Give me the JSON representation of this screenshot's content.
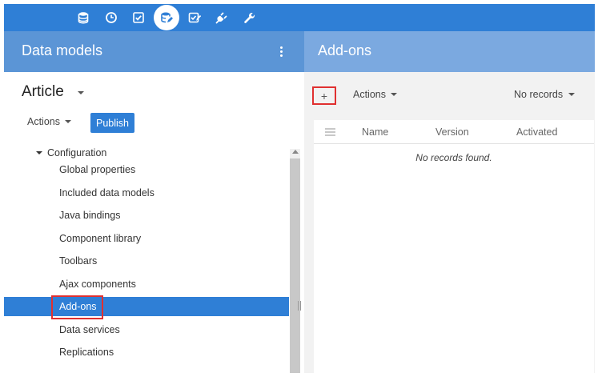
{
  "topbar": {
    "icons": [
      "database-icon",
      "clock-icon",
      "checkbox-icon",
      "data-model-icon",
      "edit-check-icon",
      "plug-icon",
      "wrench-icon"
    ],
    "active_icon": "data-model-icon"
  },
  "left": {
    "header_title": "Data models",
    "entity": "Article",
    "actions_label": "Actions",
    "publish_label": "Publish",
    "tree": {
      "parent": "Configuration",
      "items": [
        {
          "label": "Global properties"
        },
        {
          "label": "Included data models"
        },
        {
          "label": "Java bindings"
        },
        {
          "label": "Component library"
        },
        {
          "label": "Toolbars"
        },
        {
          "label": "Ajax components"
        },
        {
          "label": "Add-ons"
        },
        {
          "label": "Data services"
        },
        {
          "label": "Replications"
        }
      ],
      "selected_index": 6
    }
  },
  "right": {
    "header_title": "Add-ons",
    "add_label": "+",
    "actions_label": "Actions",
    "records_filter": "No records",
    "table": {
      "columns": [
        "Name",
        "Version",
        "Activated"
      ],
      "empty_message": "No records found."
    }
  },
  "colors": {
    "primary": "#2f7fd6",
    "left_header": "#5b95d6",
    "right_header": "#7ba9e0",
    "highlight_border": "#e03030"
  }
}
